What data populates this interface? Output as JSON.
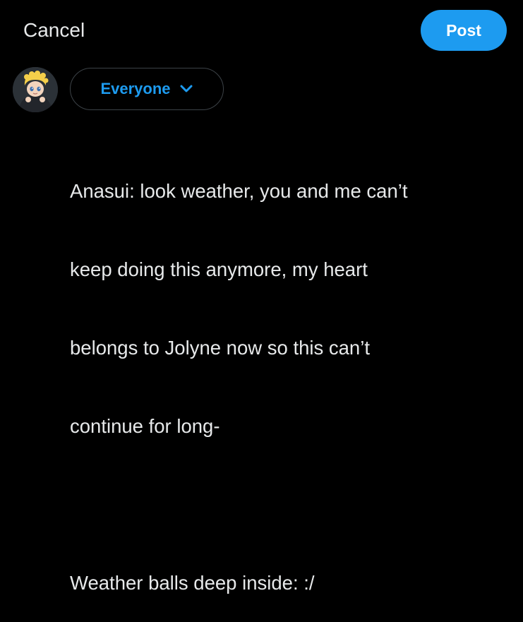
{
  "header": {
    "cancel_label": "Cancel",
    "post_label": "Post"
  },
  "audience": {
    "label": "Everyone",
    "icon": "chevron-down-icon"
  },
  "avatar": {
    "icon": "avatar"
  },
  "compose": {
    "lines": [
      "Anasui: look weather, you and me can’t",
      "keep doing this anymore, my heart",
      "belongs to Jolyne now so this can’t",
      "continue for long-",
      "",
      "Weather balls deep inside: :/"
    ]
  },
  "colors": {
    "accent": "#1d9bf0",
    "background": "#000000",
    "text": "#e7e9ea",
    "border": "#3c4247"
  }
}
